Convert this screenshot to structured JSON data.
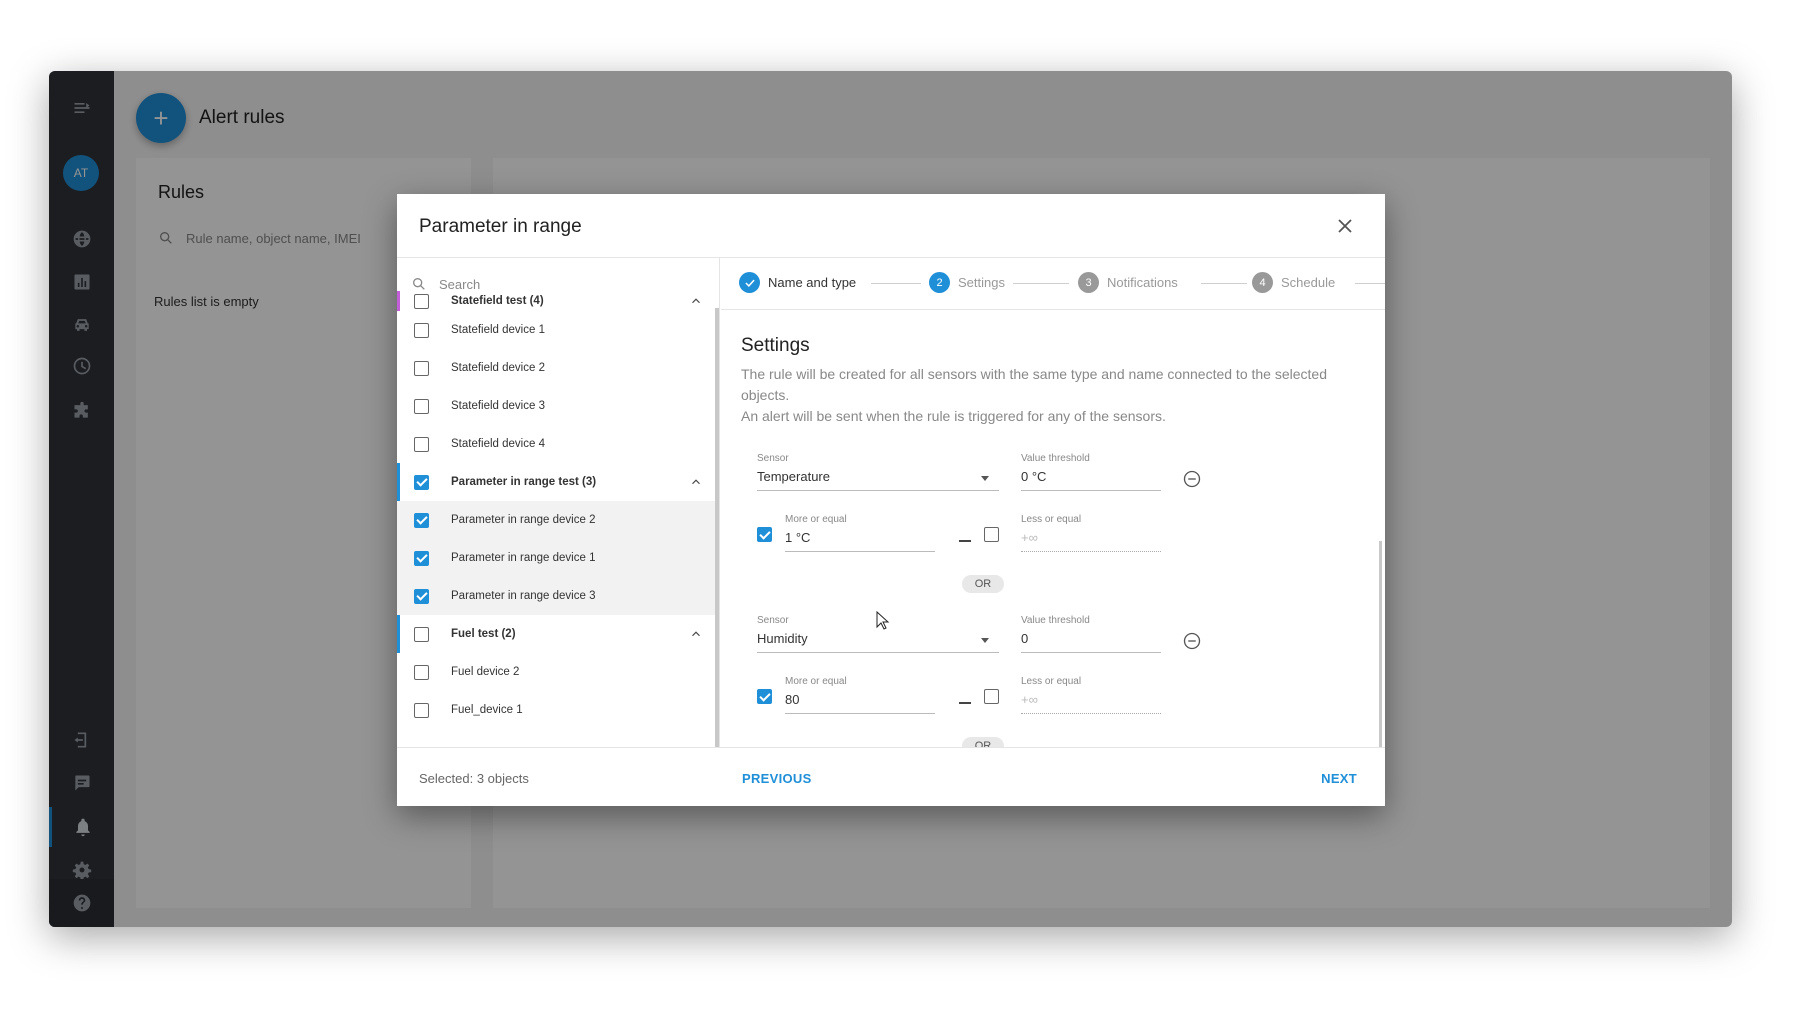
{
  "sidebar": {
    "avatar_initials": "AT",
    "icons": [
      "menu-icon",
      "globe-icon",
      "chart-icon",
      "car-icon",
      "clock-icon",
      "puzzle-icon",
      "logout-icon",
      "chat-icon",
      "bell-icon",
      "gear-icon",
      "help-icon"
    ]
  },
  "header": {
    "title": "Alert rules",
    "add_button": "+"
  },
  "rules_panel": {
    "title": "Rules",
    "search_placeholder": "Rule name, object name, IMEI",
    "empty_text": "Rules list is empty"
  },
  "dialog": {
    "title": "Parameter in range",
    "object_search_placeholder": "Search",
    "objects": [
      {
        "label": "Statefield test (4)",
        "group": true,
        "checked": false,
        "bar": "#c35dd8"
      },
      {
        "label": "Statefield device 1",
        "group": false,
        "checked": false
      },
      {
        "label": "Statefield device 2",
        "group": false,
        "checked": false
      },
      {
        "label": "Statefield device 3",
        "group": false,
        "checked": false
      },
      {
        "label": "Statefield device 4",
        "group": false,
        "checked": false
      },
      {
        "label": "Parameter in range test (3)",
        "group": true,
        "checked": true,
        "bar": "#1f8fd8"
      },
      {
        "label": "Parameter in range device 2",
        "group": false,
        "checked": true
      },
      {
        "label": "Parameter in range device 1",
        "group": false,
        "checked": true
      },
      {
        "label": "Parameter in range device 3",
        "group": false,
        "checked": true
      },
      {
        "label": "Fuel test (2)",
        "group": true,
        "checked": false,
        "bar": "#1f8fd8"
      },
      {
        "label": "Fuel device 2",
        "group": false,
        "checked": false
      },
      {
        "label": "Fuel_device 1",
        "group": false,
        "checked": false
      }
    ],
    "steps": [
      {
        "number": "",
        "label": "Name and type",
        "state": "done"
      },
      {
        "number": "2",
        "label": "Settings",
        "state": "active"
      },
      {
        "number": "3",
        "label": "Notifications",
        "state": "pending"
      },
      {
        "number": "4",
        "label": "Schedule",
        "state": "pending"
      }
    ],
    "settings": {
      "title": "Settings",
      "description_1": "The rule will be created for all sensors with the same type and name connected to the selected objects.",
      "description_2": "An alert will be sent when the rule is triggered for any of the sensors.",
      "conditions": [
        {
          "sensor_label": "Sensor",
          "sensor_value": "Temperature",
          "threshold_label": "Value threshold",
          "threshold_value": "0 °C",
          "more_label": "More or equal",
          "more_value": "1 °C",
          "more_checked": true,
          "less_label": "Less or equal",
          "less_placeholder": "+∞",
          "less_checked": false
        },
        {
          "sensor_label": "Sensor",
          "sensor_value": "Humidity",
          "threshold_label": "Value threshold",
          "threshold_value": "0",
          "more_label": "More or equal",
          "more_value": "80",
          "more_checked": true,
          "less_label": "Less or equal",
          "less_placeholder": "+∞",
          "less_checked": false
        }
      ],
      "or_label": "OR"
    },
    "footer": {
      "selected_text": "Selected: 3 objects",
      "previous_label": "PREVIOUS",
      "next_label": "NEXT"
    }
  },
  "colors": {
    "accent": "#1f8fd8",
    "sidebar_bg": "#2f333a",
    "statefield_bar": "#c35dd8"
  }
}
